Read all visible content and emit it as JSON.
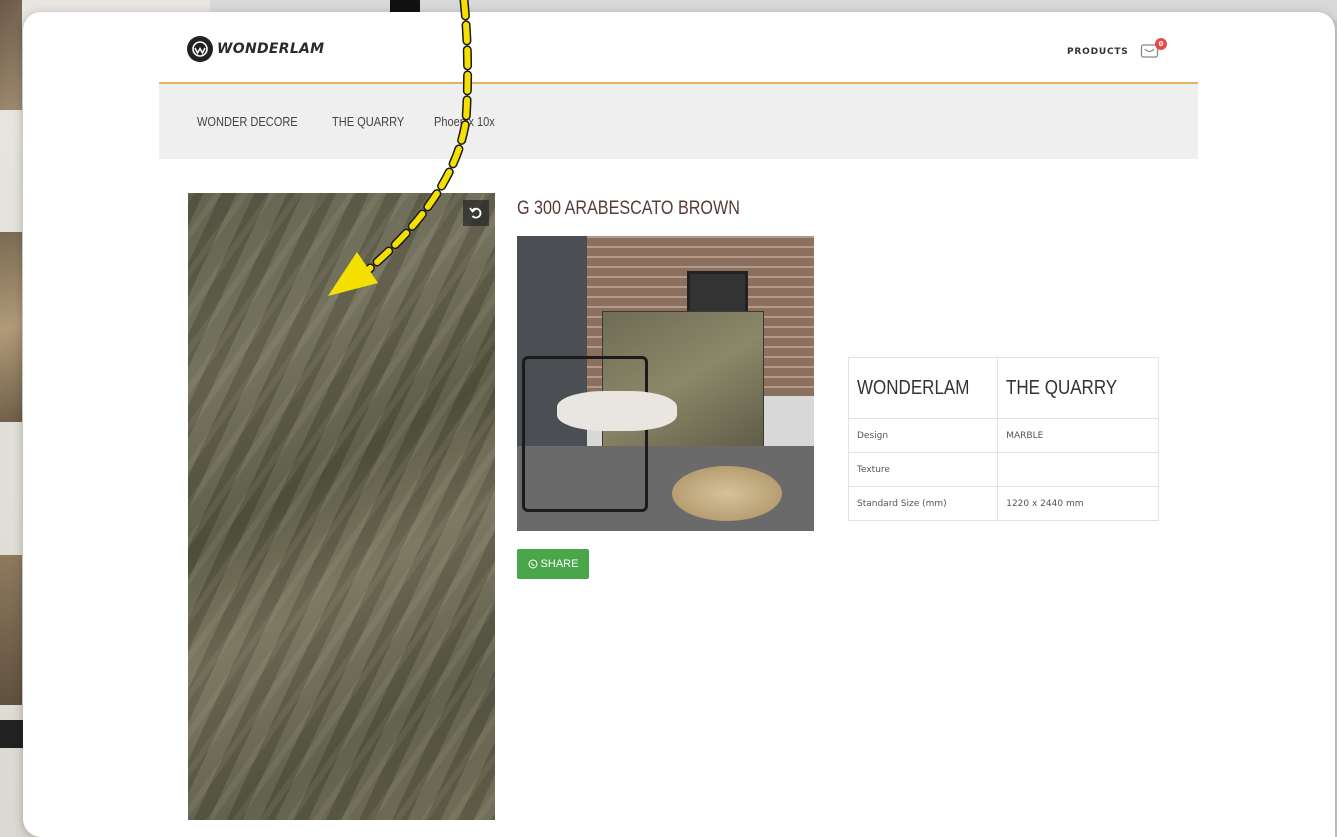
{
  "header": {
    "logo_text": "WONDERLAM",
    "products_link": "PRODUCTS",
    "cart_count": "0"
  },
  "subnav": {
    "items": [
      "WONDER DECORE",
      "THE QUARRY",
      "Phoenix 10x"
    ]
  },
  "product": {
    "title": "G 300 ARABESCATO BROWN",
    "share_label": "SHARE",
    "spec_header": {
      "brand": "WONDERLAM",
      "collection": "THE QUARRY"
    },
    "specs": [
      {
        "label": "Design",
        "value": "MARBLE"
      },
      {
        "label": "Texture",
        "value": ""
      },
      {
        "label": "Standard Size (mm)",
        "value": "1220 x 2440 mm"
      }
    ]
  },
  "icons": {
    "rotate": "rotate-icon",
    "cart": "cart-icon",
    "whatsapp": "whatsapp-icon",
    "logo": "wonderlam-logo"
  },
  "colors": {
    "accent_line": "#e6b262",
    "title": "#5a3a38",
    "share_button": "#4aa64a",
    "cart_badge": "#e84a4a",
    "annotation_arrow": "#f5e000"
  }
}
